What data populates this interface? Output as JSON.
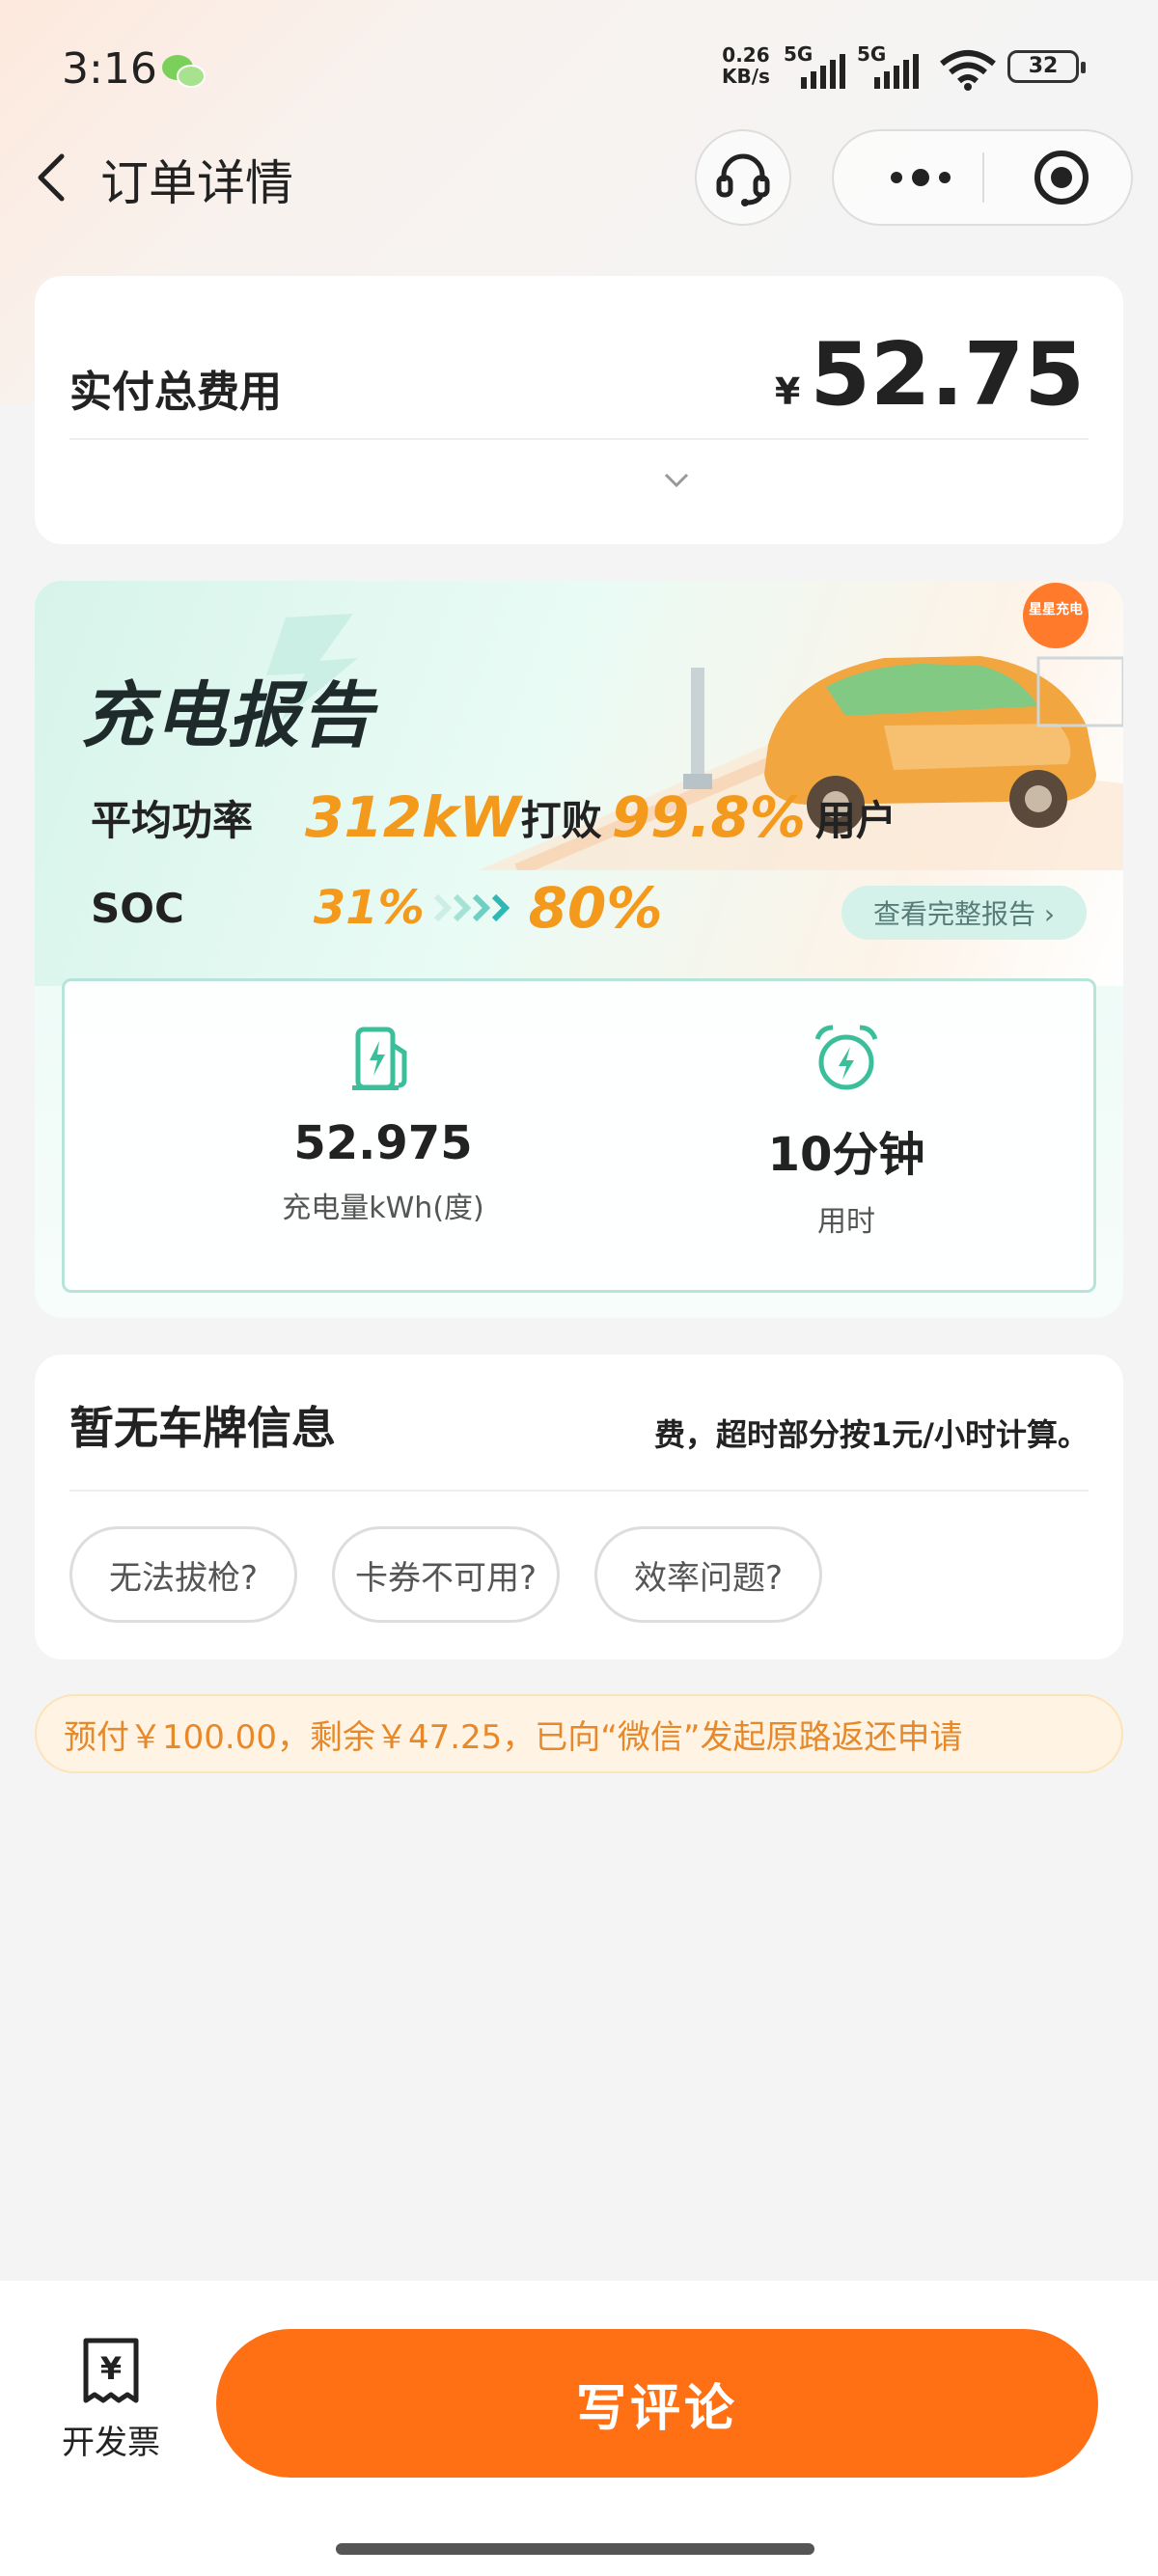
{
  "status": {
    "time": "3:16",
    "net_speed": "0.26",
    "net_unit": "KB/s",
    "net_type1": "5G",
    "net_type2": "5G",
    "battery": "32"
  },
  "nav": {
    "title": "订单详情"
  },
  "total": {
    "label": "实付总费用",
    "currency": "¥",
    "amount": "52.75"
  },
  "report": {
    "title": "充电报告",
    "avg_power_label": "平均功率",
    "avg_power_value": "312kW",
    "beat_text": "打败",
    "beat_percent": "99.8%",
    "users_text": "用户",
    "soc_label": "SOC",
    "soc_start": "31%",
    "soc_end": "80%",
    "full_report_label": "查看完整报告 ›",
    "badge_text": "星星充电",
    "energy_value": "52.975",
    "energy_label": "充电量kWh(度)",
    "duration_value": "10分钟",
    "duration_label": "用时"
  },
  "plate": {
    "title": "暂无车牌信息",
    "notice": "费，超时部分按1元/小时计算。",
    "chips": [
      "无法拔枪?",
      "卡券不可用?",
      "效率问题?"
    ]
  },
  "prepay_notice": "预付￥100.00，剩余￥47.25，已向“微信”发起原路返还申请",
  "bottom": {
    "invoice_icon": "¥",
    "invoice_label": "开发票",
    "write_review_label": "写评论"
  },
  "colors": {
    "accent": "#ff7014",
    "orange_text": "#f39a1d",
    "teal": "#3bbf9a",
    "notice_bg": "#fff4e3"
  }
}
